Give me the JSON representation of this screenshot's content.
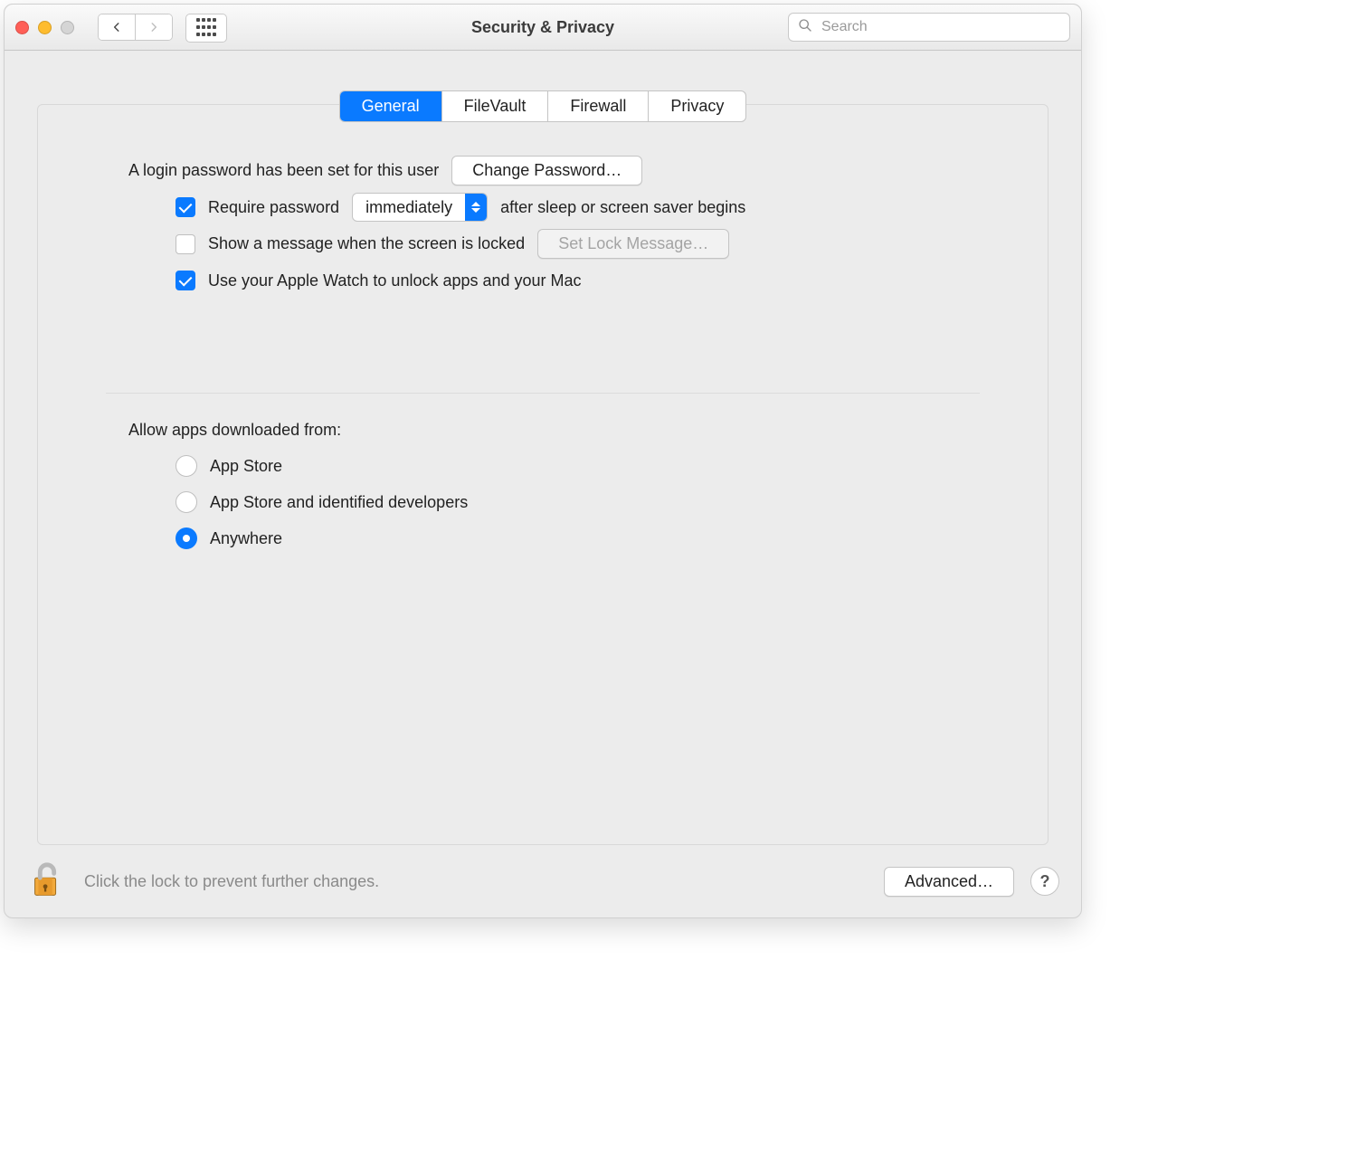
{
  "window": {
    "title": "Security & Privacy",
    "search_placeholder": "Search"
  },
  "tabs": [
    {
      "label": "General",
      "active": true
    },
    {
      "label": "FileVault",
      "active": false
    },
    {
      "label": "Firewall",
      "active": false
    },
    {
      "label": "Privacy",
      "active": false
    }
  ],
  "login_password": {
    "status_text": "A login password has been set for this user",
    "change_button": "Change Password…"
  },
  "require_password": {
    "checked": true,
    "label_before": "Require password",
    "dropdown_value": "immediately",
    "label_after": "after sleep or screen saver begins"
  },
  "lock_message": {
    "checked": false,
    "label": "Show a message when the screen is locked",
    "button": "Set Lock Message…",
    "button_disabled": true
  },
  "apple_watch": {
    "checked": true,
    "label": "Use your Apple Watch to unlock apps and your Mac"
  },
  "gatekeeper": {
    "heading": "Allow apps downloaded from:",
    "options": [
      {
        "label": "App Store",
        "selected": false
      },
      {
        "label": "App Store and identified developers",
        "selected": false
      },
      {
        "label": "Anywhere",
        "selected": true
      }
    ]
  },
  "footer": {
    "lock_text": "Click the lock to prevent further changes.",
    "advanced_button": "Advanced…",
    "help_label": "?"
  }
}
